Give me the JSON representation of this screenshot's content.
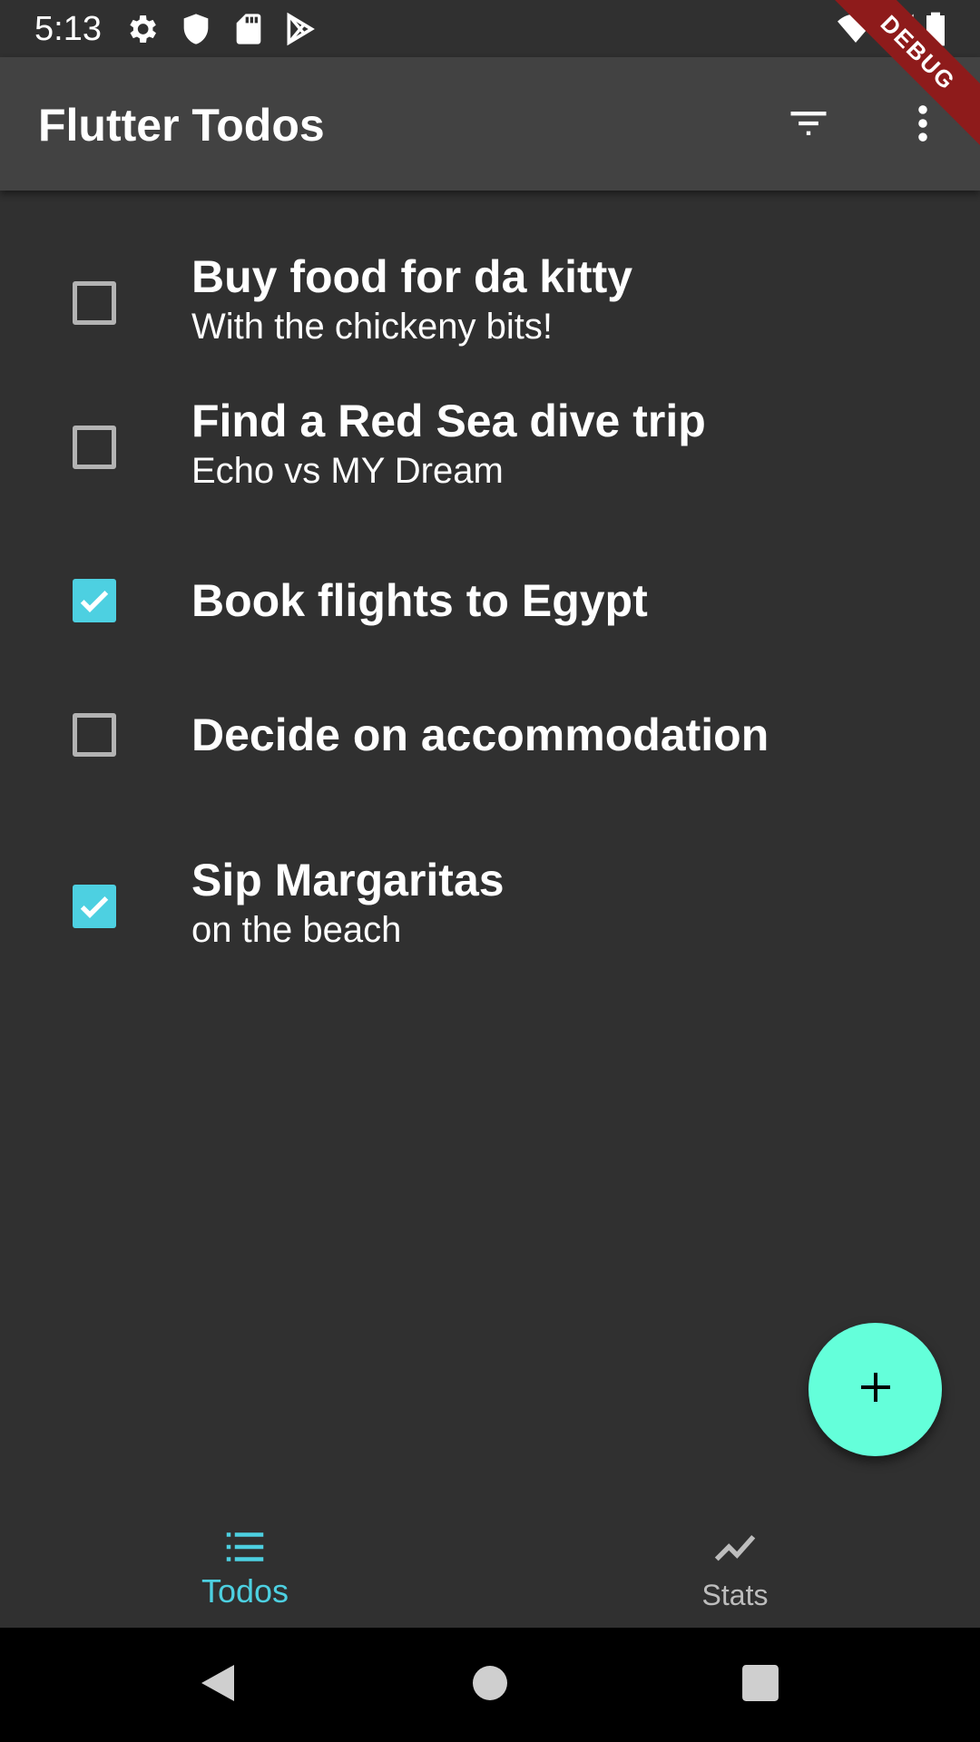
{
  "status_bar": {
    "time": "5:13",
    "left_icons": [
      "gear-icon",
      "shield-icon",
      "sd-card-icon",
      "play-store-icon"
    ],
    "right_icons": [
      "wifi-icon",
      "signal-icon",
      "battery-icon"
    ]
  },
  "debug_banner": "DEBUG",
  "app_bar": {
    "title": "Flutter Todos",
    "filter_icon": "filter-icon",
    "more_icon": "more-vert-icon"
  },
  "todos": [
    {
      "title": "Buy food for da kitty",
      "note": "With the chickeny bits!",
      "complete": false
    },
    {
      "title": "Find a Red Sea dive trip",
      "note": "Echo vs MY Dream",
      "complete": false
    },
    {
      "title": "Book flights to Egypt",
      "note": "",
      "complete": true
    },
    {
      "title": "Decide on accommodation",
      "note": "",
      "complete": false
    },
    {
      "title": "Sip Margaritas",
      "note": "on the beach",
      "complete": true
    }
  ],
  "fab": {
    "icon": "add-icon"
  },
  "bottom_nav": {
    "items": [
      {
        "label": "Todos",
        "icon": "list-icon",
        "selected": true
      },
      {
        "label": "Stats",
        "icon": "show-chart-icon",
        "selected": false
      }
    ]
  },
  "system_nav": {
    "back": "back-icon",
    "home": "home-icon",
    "recents": "recents-icon"
  },
  "colors": {
    "background": "#303030",
    "app_bar": "#424242",
    "accent": "#4dd0e1",
    "fab": "#64ffda",
    "checkbox_border": "#b3b3b3",
    "nav_inactive": "#bdbdbd",
    "debug_banner": "#8e1b1b"
  }
}
